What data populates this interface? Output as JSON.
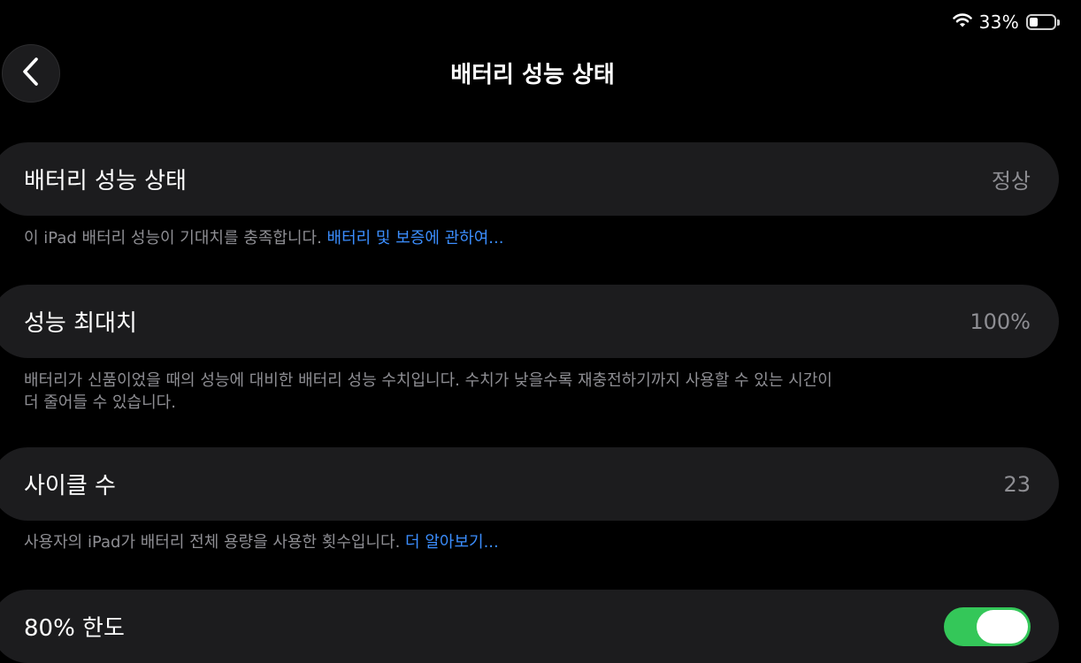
{
  "status_bar": {
    "battery_percent": "33%",
    "battery_level": 0.33,
    "wifi_icon": "wifi-icon",
    "battery_icon": "battery-icon"
  },
  "header": {
    "back_icon": "chevron-left-icon",
    "title": "배터리 성능 상태"
  },
  "sections": {
    "battery_health": {
      "label": "배터리 성능 상태",
      "value": "정상",
      "footnote": "이 iPad 배터리 성능이 기대치를 충족합니다. ",
      "link": "배터리 및 보증에 관하여..."
    },
    "maximum_capacity": {
      "label": "성능 최대치",
      "value": "100%",
      "footnote_line1": "배터리가 신품이었을 때의 성능에 대비한 배터리 성능 수치입니다. 수치가 낮을수록 재충전하기까지 사용할 수 있는 시간이",
      "footnote_line2": "더 줄어들 수 있습니다."
    },
    "cycle_count": {
      "label": "사이클 수",
      "value": "23",
      "footnote": "사용자의 iPad가 배터리 전체 용량을 사용한 횟수입니다. ",
      "link": "더 알아보기..."
    },
    "limit_80": {
      "label": "80% 한도",
      "toggle_on": true
    }
  },
  "colors": {
    "background": "#000000",
    "card": "#1c1c1e",
    "secondary_text": "#8e8e93",
    "link": "#3b8eff",
    "toggle_on": "#34c759"
  }
}
